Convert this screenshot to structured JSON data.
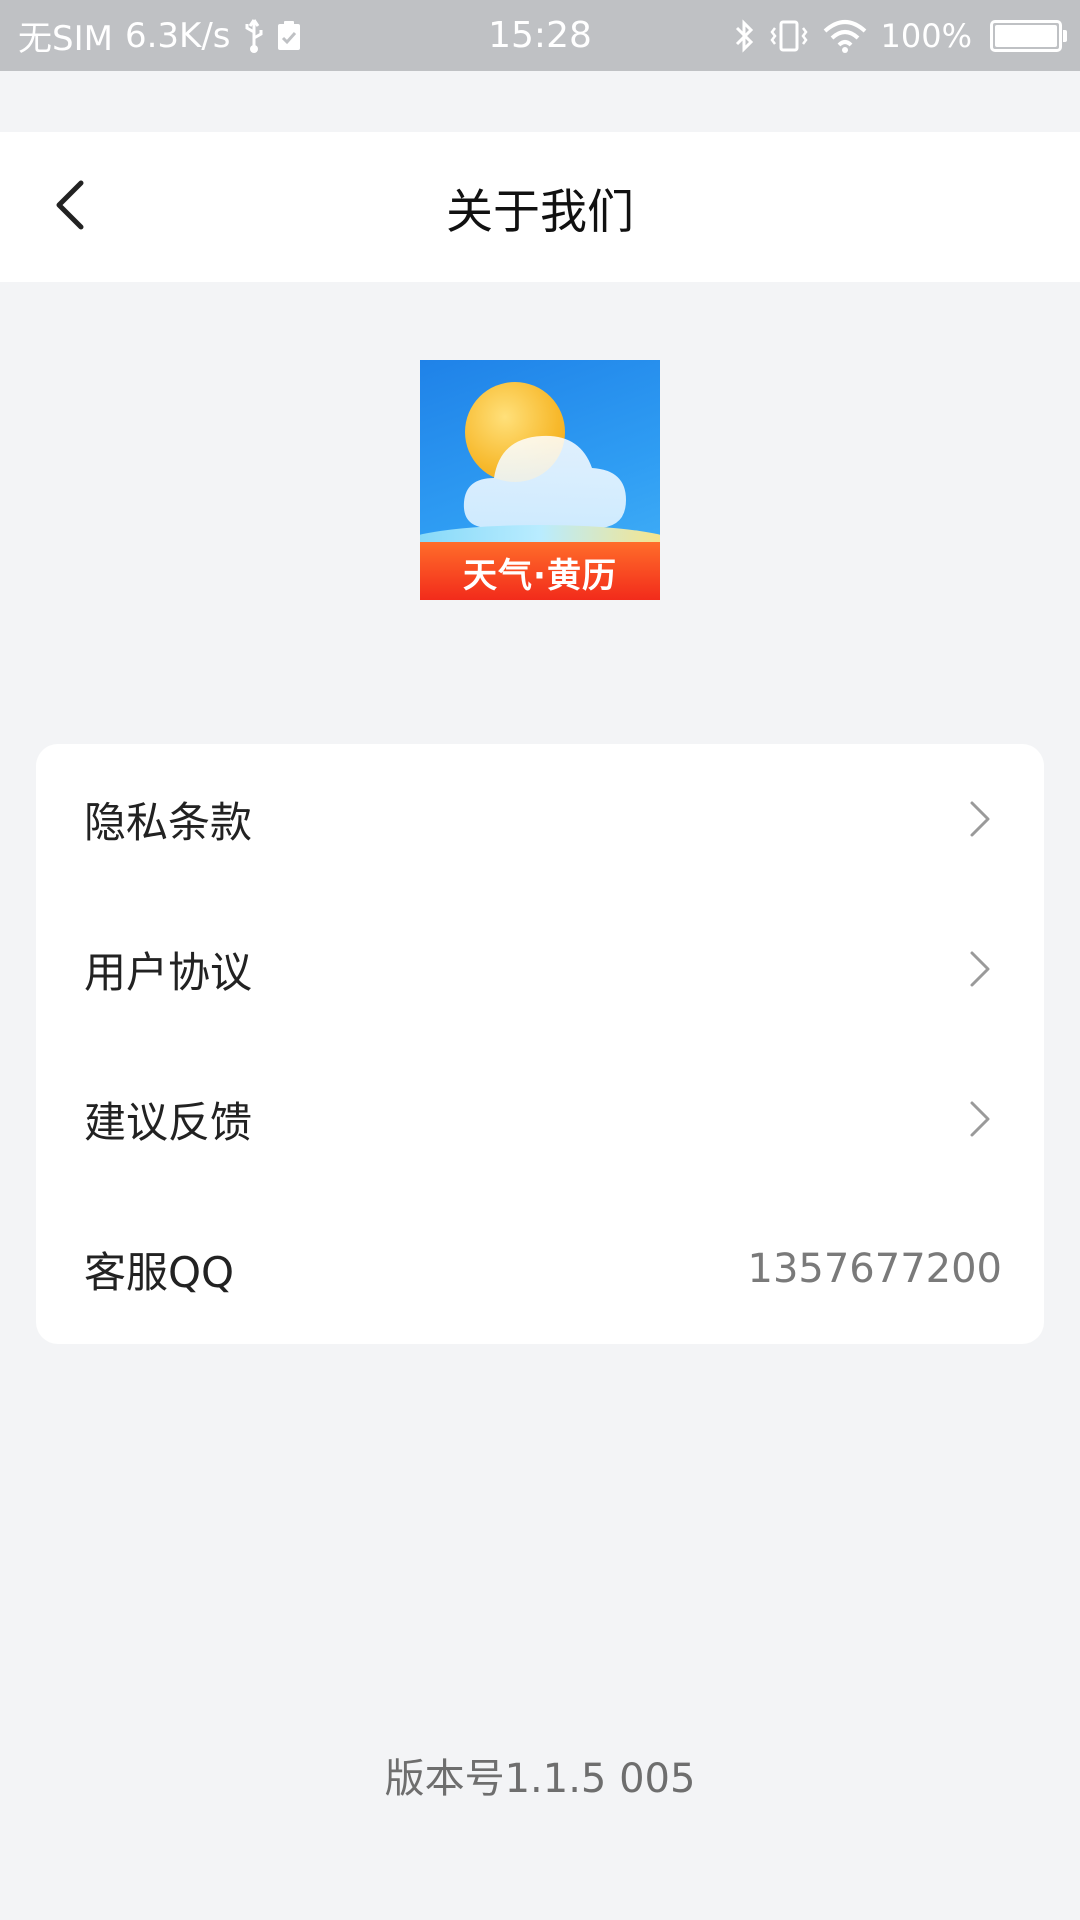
{
  "status_bar": {
    "carrier": "无SIM",
    "network_speed": "6.3K/s",
    "time": "15:28",
    "battery_percent_label": "100%",
    "battery_level": 1.0,
    "icons": [
      "usb-icon",
      "clipboard-check-icon",
      "bluetooth-icon",
      "vibrate-icon",
      "wifi-icon",
      "battery-icon"
    ]
  },
  "nav": {
    "title": "关于我们",
    "back_icon": "chevron-left-icon"
  },
  "app_logo": {
    "text": "天气·黄历"
  },
  "menu": {
    "items": [
      {
        "label": "隐私条款",
        "icon": "chevron-right-icon"
      },
      {
        "label": "用户协议",
        "icon": "chevron-right-icon"
      },
      {
        "label": "建议反馈",
        "icon": "chevron-right-icon"
      },
      {
        "label": "客服QQ",
        "value": "1357677200"
      }
    ]
  },
  "version": "版本号1.1.5 005",
  "colors": {
    "page_bg": "#f3f4f6",
    "status_bar_bg": "#bfc1c4",
    "card_bg": "#ffffff",
    "title_text": "#111111",
    "secondary_text": "#7a7a7a"
  }
}
